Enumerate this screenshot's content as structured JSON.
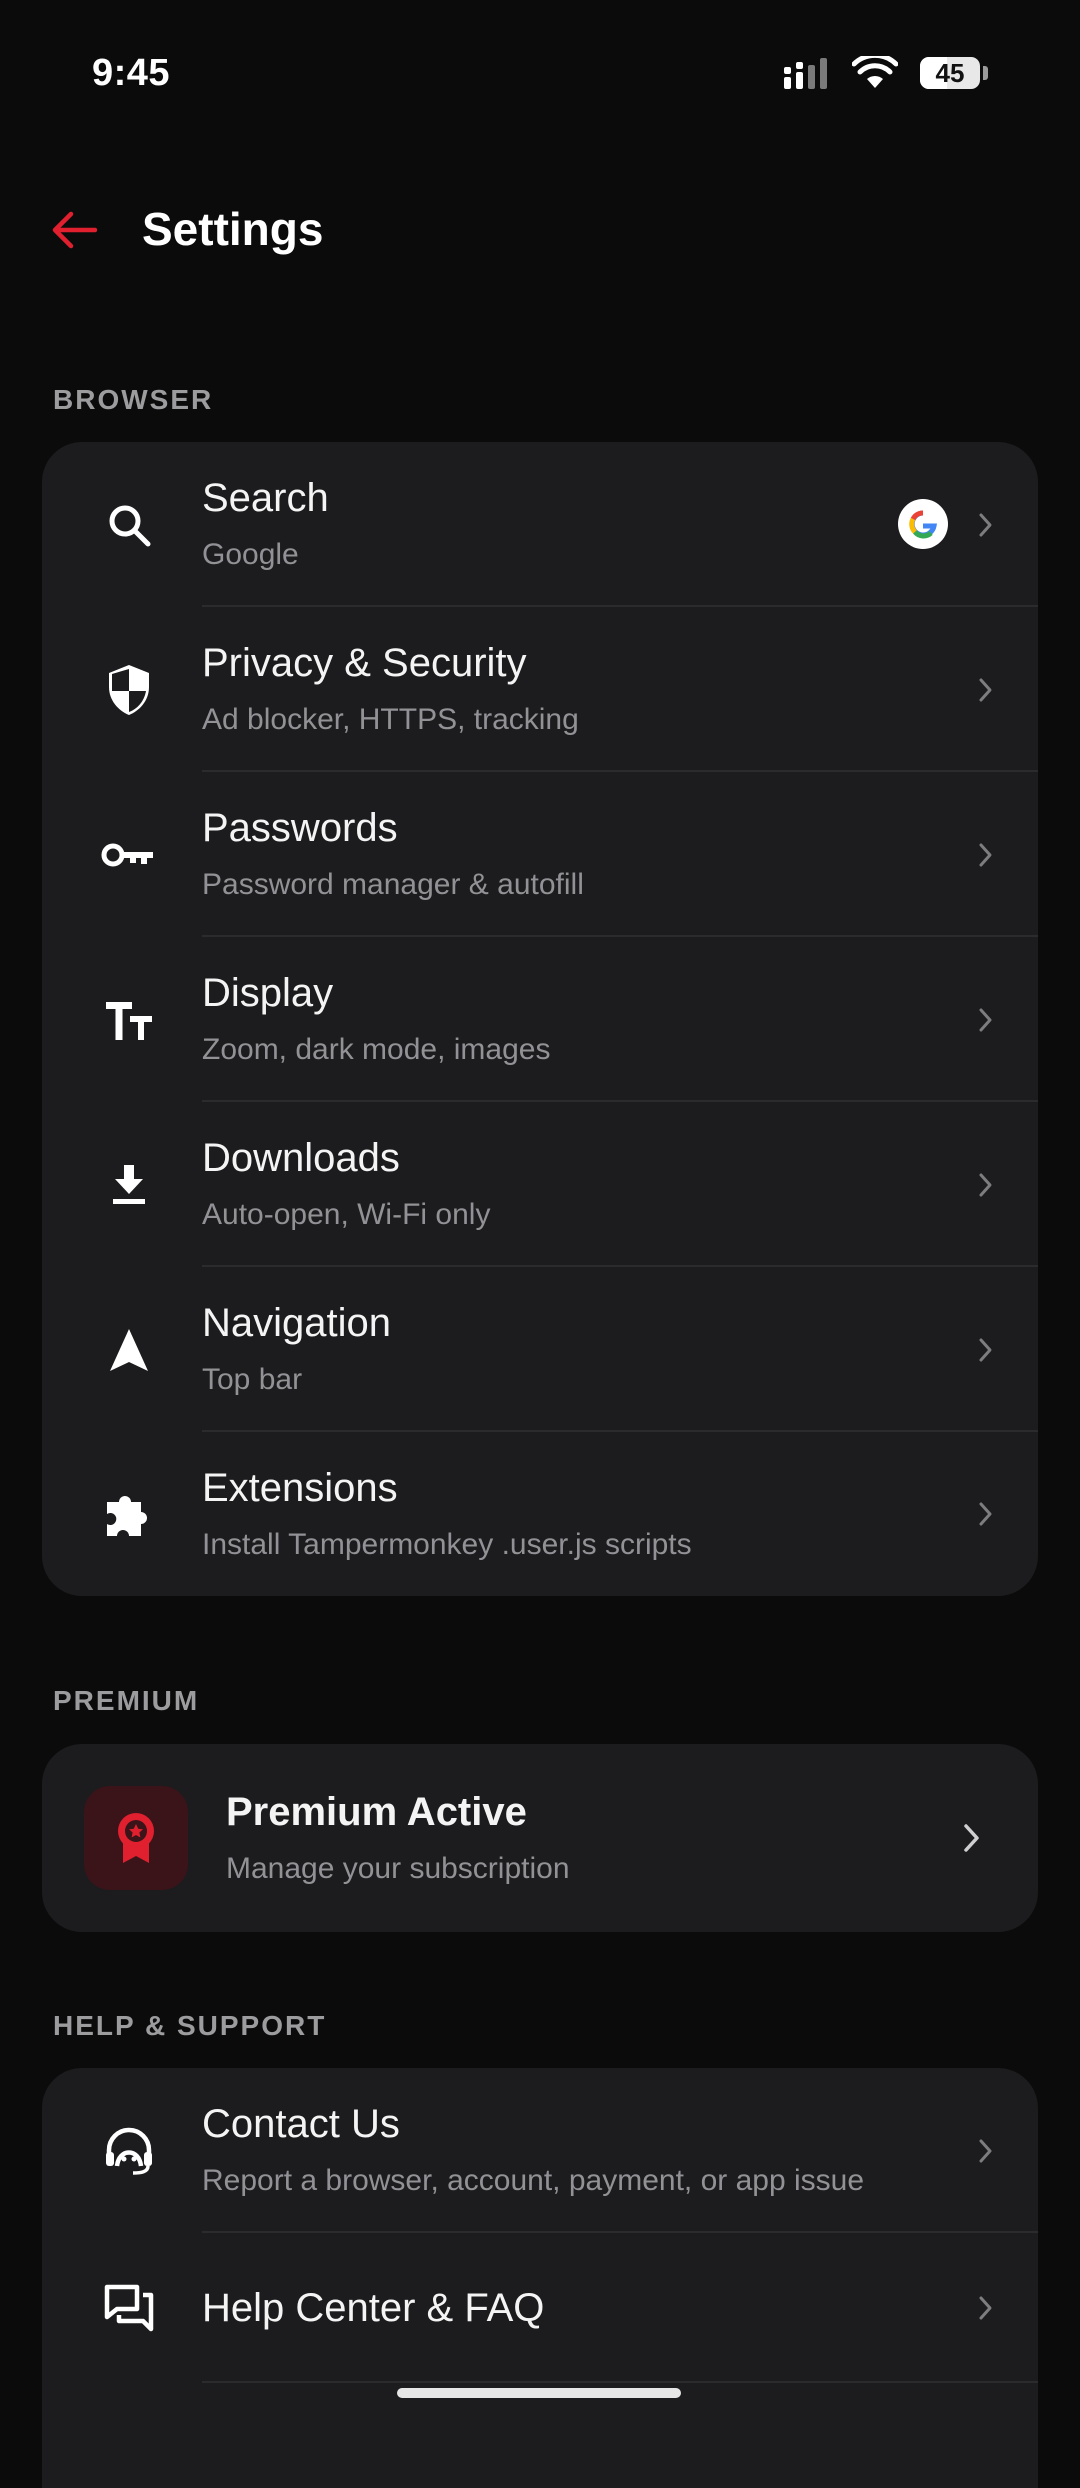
{
  "status_bar": {
    "time": "9:45",
    "battery": "45",
    "battery_level": 0.45
  },
  "header": {
    "title": "Settings"
  },
  "sections": {
    "browser": {
      "label": "BROWSER",
      "items": [
        {
          "title": "Search",
          "subtitle": "Google",
          "icon": "search-icon",
          "trailing_icon": "google-logo-icon"
        },
        {
          "title": "Privacy & Security",
          "subtitle": "Ad blocker, HTTPS, tracking",
          "icon": "shield-icon"
        },
        {
          "title": "Passwords",
          "subtitle": "Password manager & autofill",
          "icon": "key-icon"
        },
        {
          "title": "Display",
          "subtitle": "Zoom, dark mode, images",
          "icon": "text-size-icon"
        },
        {
          "title": "Downloads",
          "subtitle": "Auto-open, Wi-Fi only",
          "icon": "download-icon"
        },
        {
          "title": "Navigation",
          "subtitle": "Top bar",
          "icon": "navigation-arrow-icon"
        },
        {
          "title": "Extensions",
          "subtitle": "Install Tampermonkey .user.js scripts",
          "icon": "puzzle-icon"
        }
      ]
    },
    "premium": {
      "label": "PREMIUM",
      "title": "Premium Active",
      "subtitle": "Manage your subscription",
      "icon": "award-badge-icon"
    },
    "help": {
      "label": "HELP & SUPPORT",
      "items": [
        {
          "title": "Contact Us",
          "subtitle": "Report a browser, account, payment, or app issue",
          "icon": "headset-icon"
        },
        {
          "title": "Help Center & FAQ",
          "icon": "chat-bubbles-icon"
        }
      ]
    }
  },
  "colors": {
    "accent": "#e0202e",
    "background": "#0b0b0c",
    "card": "#1c1c1e"
  }
}
